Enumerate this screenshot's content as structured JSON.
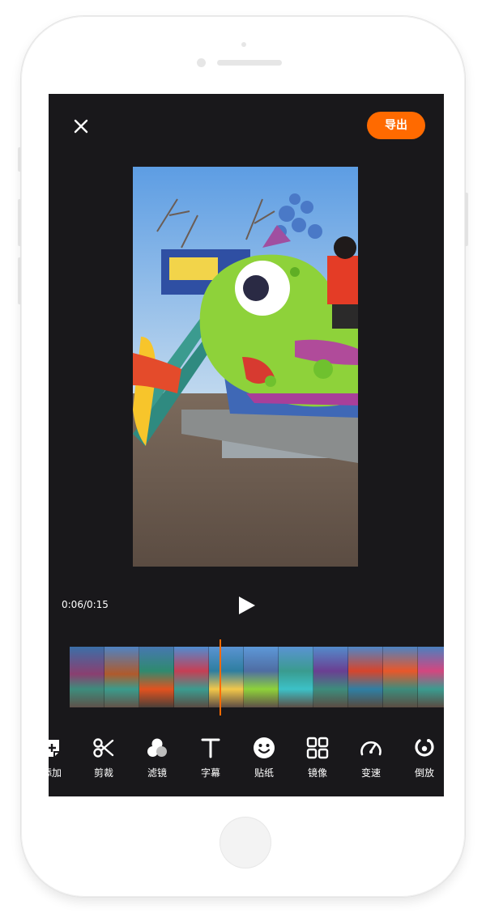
{
  "toolbar_top": {
    "export_label": "导出"
  },
  "player": {
    "time_display": "0:06/0:15",
    "progress": 0.4
  },
  "tools": [
    {
      "label": "添加",
      "icon": "add-clip-icon"
    },
    {
      "label": "剪裁",
      "icon": "scissors-icon"
    },
    {
      "label": "滤镜",
      "icon": "filter-icon"
    },
    {
      "label": "字幕",
      "icon": "text-icon"
    },
    {
      "label": "贴纸",
      "icon": "smiley-icon"
    },
    {
      "label": "镜像",
      "icon": "grid-icon"
    },
    {
      "label": "变速",
      "icon": "speedometer-icon"
    },
    {
      "label": "倒放",
      "icon": "reverse-icon"
    }
  ],
  "colors": {
    "accent": "#ff6a00",
    "screen_background": "#19181b",
    "text": "#ffffff"
  }
}
